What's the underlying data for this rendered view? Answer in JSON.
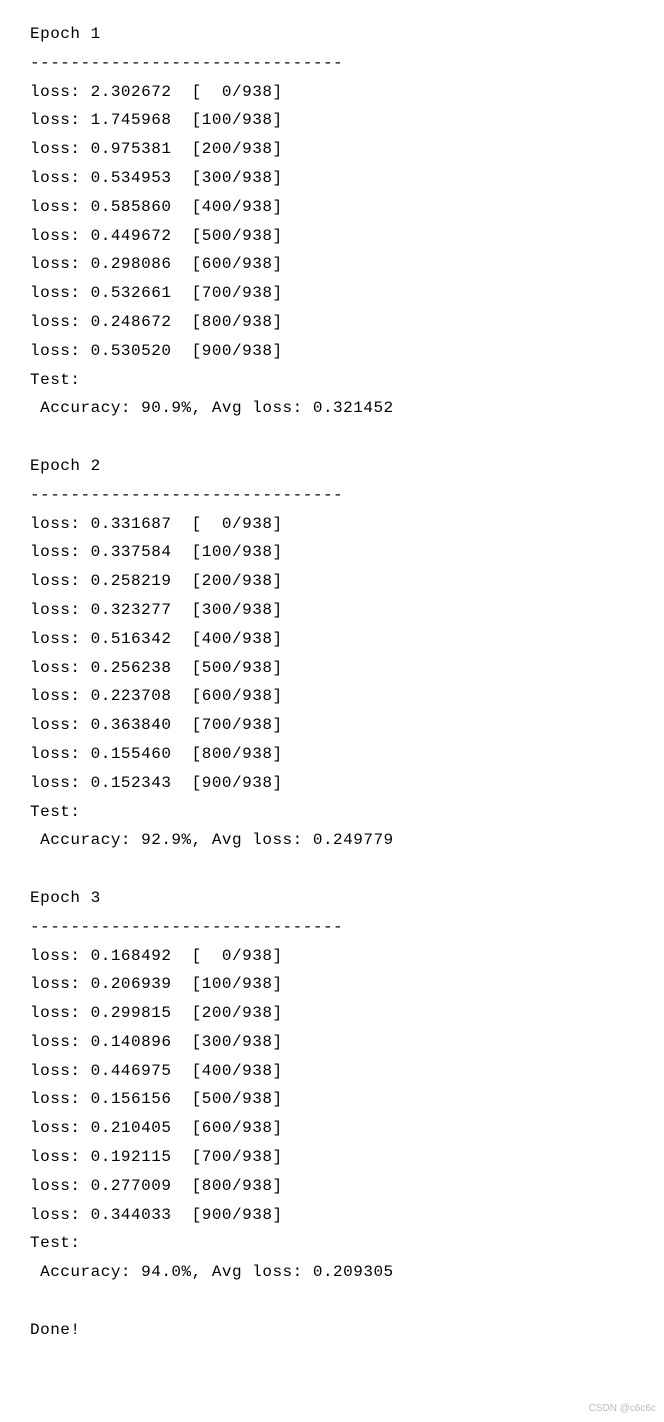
{
  "epochs": [
    {
      "header": "Epoch 1",
      "separator": "-------------------------------",
      "losses": [
        {
          "loss": "2.302672",
          "step": "  0",
          "total": "938"
        },
        {
          "loss": "1.745968",
          "step": "100",
          "total": "938"
        },
        {
          "loss": "0.975381",
          "step": "200",
          "total": "938"
        },
        {
          "loss": "0.534953",
          "step": "300",
          "total": "938"
        },
        {
          "loss": "0.585860",
          "step": "400",
          "total": "938"
        },
        {
          "loss": "0.449672",
          "step": "500",
          "total": "938"
        },
        {
          "loss": "0.298086",
          "step": "600",
          "total": "938"
        },
        {
          "loss": "0.532661",
          "step": "700",
          "total": "938"
        },
        {
          "loss": "0.248672",
          "step": "800",
          "total": "938"
        },
        {
          "loss": "0.530520",
          "step": "900",
          "total": "938"
        }
      ],
      "test_label": "Test:",
      "accuracy": "90.9%",
      "avg_loss": "0.321452"
    },
    {
      "header": "Epoch 2",
      "separator": "-------------------------------",
      "losses": [
        {
          "loss": "0.331687",
          "step": "  0",
          "total": "938"
        },
        {
          "loss": "0.337584",
          "step": "100",
          "total": "938"
        },
        {
          "loss": "0.258219",
          "step": "200",
          "total": "938"
        },
        {
          "loss": "0.323277",
          "step": "300",
          "total": "938"
        },
        {
          "loss": "0.516342",
          "step": "400",
          "total": "938"
        },
        {
          "loss": "0.256238",
          "step": "500",
          "total": "938"
        },
        {
          "loss": "0.223708",
          "step": "600",
          "total": "938"
        },
        {
          "loss": "0.363840",
          "step": "700",
          "total": "938"
        },
        {
          "loss": "0.155460",
          "step": "800",
          "total": "938"
        },
        {
          "loss": "0.152343",
          "step": "900",
          "total": "938"
        }
      ],
      "test_label": "Test:",
      "accuracy": "92.9%",
      "avg_loss": "0.249779"
    },
    {
      "header": "Epoch 3",
      "separator": "-------------------------------",
      "losses": [
        {
          "loss": "0.168492",
          "step": "  0",
          "total": "938"
        },
        {
          "loss": "0.206939",
          "step": "100",
          "total": "938"
        },
        {
          "loss": "0.299815",
          "step": "200",
          "total": "938"
        },
        {
          "loss": "0.140896",
          "step": "300",
          "total": "938"
        },
        {
          "loss": "0.446975",
          "step": "400",
          "total": "938"
        },
        {
          "loss": "0.156156",
          "step": "500",
          "total": "938"
        },
        {
          "loss": "0.210405",
          "step": "600",
          "total": "938"
        },
        {
          "loss": "0.192115",
          "step": "700",
          "total": "938"
        },
        {
          "loss": "0.277009",
          "step": "800",
          "total": "938"
        },
        {
          "loss": "0.344033",
          "step": "900",
          "total": "938"
        }
      ],
      "test_label": "Test:",
      "accuracy": "94.0%",
      "avg_loss": "0.209305"
    }
  ],
  "done": "Done!",
  "watermark": "CSDN @c6c6c"
}
